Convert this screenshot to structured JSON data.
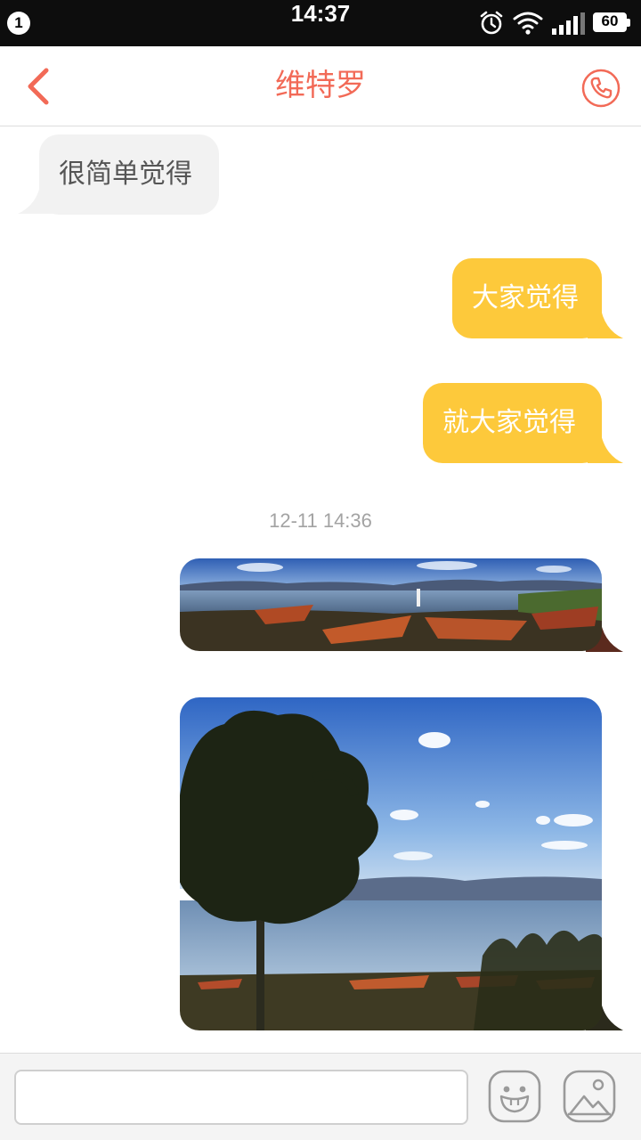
{
  "status_bar": {
    "notification_count": "1",
    "time": "14:37",
    "battery": "60",
    "icons": [
      "alarm-icon",
      "wifi-icon",
      "signal-icon",
      "battery-icon"
    ]
  },
  "header": {
    "title": "维特罗",
    "back_icon": "chevron-left-icon",
    "call_icon": "phone-icon",
    "accent_color": "#f26a57"
  },
  "messages": [
    {
      "direction": "incoming",
      "type": "text",
      "text": "很简单觉得"
    },
    {
      "direction": "outgoing",
      "type": "text",
      "text": "大家觉得"
    },
    {
      "direction": "outgoing",
      "type": "text",
      "text": "就大家觉得"
    },
    {
      "type": "timestamp",
      "text": "12-11 14:36"
    },
    {
      "direction": "outgoing",
      "type": "image",
      "content": "panorama of lake with wooden boats on shore"
    },
    {
      "direction": "outgoing",
      "type": "image",
      "content": "tree silhouette by a lake under blue sky with boats on shore"
    }
  ],
  "colors": {
    "incoming_bubble": "#f2f2f2",
    "outgoing_bubble": "#fdc93b",
    "timestamp_text": "#a3a3a3"
  },
  "input_bar": {
    "placeholder": "",
    "emoji_icon": "emoji-face-icon",
    "photo_icon": "image-icon"
  }
}
